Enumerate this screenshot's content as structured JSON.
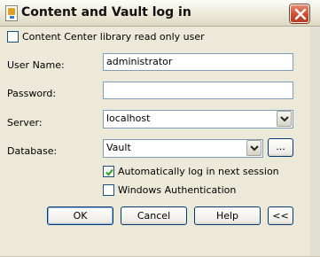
{
  "window": {
    "title": "Content and Vault log in",
    "close_label": "close"
  },
  "form": {
    "library_checkbox": {
      "label": "Content Center library read only user",
      "checked": false
    },
    "username": {
      "label": "User Name:",
      "value": "administrator"
    },
    "password": {
      "label": "Password:",
      "value": ""
    },
    "server": {
      "label": "Server:",
      "value": "localhost"
    },
    "database": {
      "label": "Database:",
      "value": "Vault",
      "browse_label": "..."
    },
    "auto_login": {
      "label": "Automatically log in next session",
      "checked": true
    },
    "windows_auth": {
      "label": "Windows Authentication",
      "checked": false
    }
  },
  "buttons": {
    "ok": "OK",
    "cancel": "Cancel",
    "help": "Help",
    "collapse": "<<"
  },
  "colors": {
    "dialog_bg": "#ece9d8",
    "close_button": "#c74b2d",
    "field_border": "#7f9db9"
  }
}
